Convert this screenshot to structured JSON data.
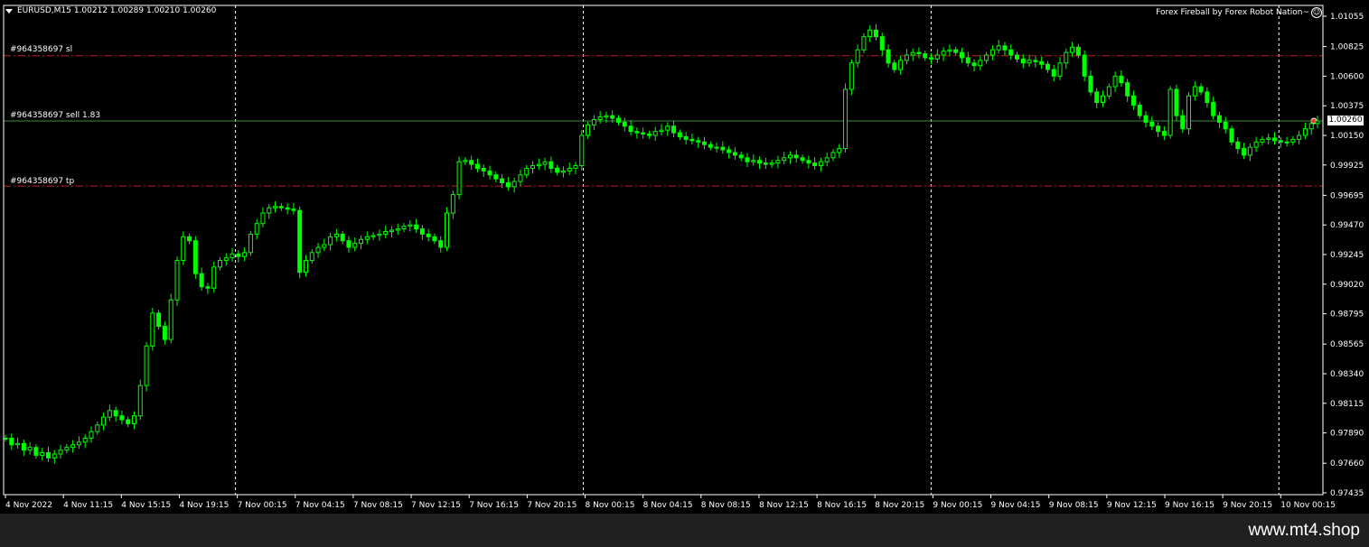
{
  "chart_header": {
    "symbol": "EURUSD,M15",
    "ohlc": "1.00212 1.00289 1.00210 1.00260",
    "expert_label": "Forex Fireball by Forex Robot Nation~"
  },
  "orders": [
    {
      "label": "#964358697 sl",
      "price": 1.00755,
      "color": "#c81e1e"
    },
    {
      "label": "#964358697 sell 1.83",
      "price": 1.0026,
      "color": "#3c8c3c"
    },
    {
      "label": "#964358697 tp",
      "price": 0.99765,
      "color": "#c81e1e"
    }
  ],
  "current_price_label": "1.00260",
  "watermark": "www.mt4.shop",
  "colors": {
    "background": "#000000",
    "candles": "#00ff00",
    "axis": "#ffffff",
    "grid": "#ffffff"
  },
  "chart_data": {
    "type": "candlestick",
    "title": "EURUSD,M15",
    "ylim": [
      0.97435,
      1.01055
    ],
    "y_ticks": [
      "1.01055",
      "1.00825",
      "1.00600",
      "1.00375",
      "1.00150",
      "0.99925",
      "0.99695",
      "0.99470",
      "0.99245",
      "0.99020",
      "0.98795",
      "0.98565",
      "0.98340",
      "0.98115",
      "0.97890",
      "0.97660",
      "0.97435"
    ],
    "x_ticks": [
      "4 Nov 2022",
      "4 Nov 11:15",
      "4 Nov 15:15",
      "4 Nov 19:15",
      "7 Nov 00:15",
      "7 Nov 04:15",
      "7 Nov 08:15",
      "7 Nov 12:15",
      "7 Nov 16:15",
      "7 Nov 20:15",
      "8 Nov 00:15",
      "8 Nov 04:15",
      "8 Nov 08:15",
      "8 Nov 12:15",
      "8 Nov 16:15",
      "8 Nov 20:15",
      "9 Nov 00:15",
      "9 Nov 04:15",
      "9 Nov 08:15",
      "9 Nov 12:15",
      "9 Nov 16:15",
      "9 Nov 20:15",
      "10 Nov 00:15"
    ],
    "day_separators": [
      "7 Nov 00:15",
      "8 Nov 00:15",
      "9 Nov 00:15",
      "10 Nov 00:15"
    ],
    "series": [
      {
        "name": "EURUSD,M15",
        "close": [
          0.9785,
          0.978,
          0.9781,
          0.9776,
          0.9778,
          0.9772,
          0.9774,
          0.977,
          0.9773,
          0.9776,
          0.9778,
          0.978,
          0.9782,
          0.9785,
          0.979,
          0.9795,
          0.9801,
          0.9806,
          0.9802,
          0.9799,
          0.9796,
          0.9802,
          0.9825,
          0.9855,
          0.988,
          0.987,
          0.986,
          0.989,
          0.992,
          0.9938,
          0.9935,
          0.991,
          0.99,
          0.9899,
          0.9915,
          0.992,
          0.9922,
          0.9925,
          0.9923,
          0.9926,
          0.994,
          0.9948,
          0.9956,
          0.996,
          0.9961,
          0.996,
          0.9959,
          0.9958,
          0.9911,
          0.992,
          0.9926,
          0.993,
          0.9932,
          0.9938,
          0.994,
          0.9935,
          0.993,
          0.9933,
          0.9936,
          0.9938,
          0.9939,
          0.994,
          0.9942,
          0.9943,
          0.9944,
          0.9946,
          0.9947,
          0.9944,
          0.994,
          0.9938,
          0.9935,
          0.993,
          0.9956,
          0.997,
          0.9995,
          0.9996,
          0.9993,
          0.999,
          0.9988,
          0.9985,
          0.9982,
          0.9979,
          0.9976,
          0.998,
          0.9985,
          0.999,
          0.9992,
          0.9993,
          0.9995,
          0.999,
          0.9987,
          0.9988,
          0.999,
          0.9992,
          1.0015,
          1.0023,
          1.0027,
          1.0029,
          1.003,
          1.0028,
          1.0025,
          1.0022,
          1.0018,
          1.0017,
          1.0016,
          1.0015,
          1.0018,
          1.0019,
          1.0022,
          1.0017,
          1.0014,
          1.0012,
          1.0011,
          1.001,
          1.0008,
          1.0006,
          1.0006,
          1.0004,
          1.0002,
          1.0,
          0.9998,
          0.9995,
          0.9996,
          0.9994,
          0.9993,
          0.9994,
          0.9996,
          0.9998,
          1.0,
          0.9998,
          0.9996,
          0.9994,
          0.9992,
          0.9995,
          0.9998,
          1.0002,
          1.0005,
          1.005,
          1.007,
          1.008,
          1.009,
          1.0095,
          1.009,
          1.008,
          1.007,
          1.0065,
          1.0072,
          1.0076,
          1.0078,
          1.0077,
          1.0074,
          1.0073,
          1.0076,
          1.0079,
          1.008,
          1.0078,
          1.0074,
          1.007,
          1.0068,
          1.0072,
          1.0076,
          1.008,
          1.0083,
          1.008,
          1.0076,
          1.0073,
          1.007,
          1.0072,
          1.0071,
          1.0069,
          1.0065,
          1.006,
          1.007,
          1.0078,
          1.0082,
          1.0076,
          1.006,
          1.0048,
          1.004,
          1.0045,
          1.0052,
          1.006,
          1.0055,
          1.0045,
          1.0038,
          1.003,
          1.0025,
          1.0022,
          1.0018,
          1.0015,
          1.005,
          1.003,
          1.002,
          1.0045,
          1.0052,
          1.0048,
          1.004,
          1.003,
          1.0025,
          1.002,
          1.001,
          1.0005,
          1.0,
          1.0006,
          1.001,
          1.0012,
          1.0013,
          1.0011,
          1.001,
          1.001,
          1.0012,
          1.0015,
          1.002,
          1.0024,
          1.0026
        ]
      }
    ]
  }
}
